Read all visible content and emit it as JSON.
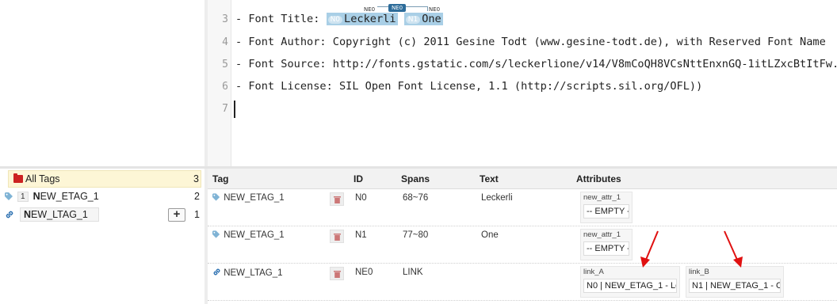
{
  "editor": {
    "lines": [
      {
        "no": "3",
        "prefix": "- Font Title: ",
        "entities": [
          {
            "badge": "N0",
            "text": "Leckerli"
          },
          {
            "badge": "N1",
            "text": "One"
          }
        ]
      },
      {
        "no": "4",
        "text": "- Font Author: Copyright (c) 2011 Gesine Todt (www.gesine-todt.de), with Reserved Font Name"
      },
      {
        "no": "5",
        "text": "- Font Source: http://fonts.gstatic.com/s/leckerlione/v14/V8mCoQH8VCsNttEnxnGQ-1itLZxcBtItFw.ttf"
      },
      {
        "no": "6",
        "text": "- Font License: SIL Open Font License, 1.1 (http://scripts.sil.org/OFL))"
      },
      {
        "no": "7",
        "text": ""
      }
    ],
    "link_labels": {
      "left": "NE0",
      "center": "NE0",
      "right": "NE0"
    }
  },
  "tree": {
    "all_tags": {
      "label": "All Tags",
      "count": "3"
    },
    "items": [
      {
        "chip": "1",
        "label_bold": "N",
        "label_rest": "EW_ETAG_1",
        "count": "2"
      },
      {
        "label_bold": "N",
        "label_rest": "EW_LTAG_1",
        "count": "1",
        "add": "+"
      }
    ]
  },
  "table": {
    "headers": {
      "tag": "Tag",
      "id": "ID",
      "spans": "Spans",
      "text": "Text",
      "attributes": "Attributes"
    },
    "rows": [
      {
        "tag": "NEW_ETAG_1",
        "id": "N0",
        "spans": "68~76",
        "text": "Leckerli",
        "attrs": [
          {
            "name": "new_attr_1",
            "value": "-- EMPTY --"
          }
        ]
      },
      {
        "tag": "NEW_ETAG_1",
        "id": "N1",
        "spans": "77~80",
        "text": "One",
        "attrs": [
          {
            "name": "new_attr_1",
            "value": "-- EMPTY --"
          }
        ]
      },
      {
        "tag": "NEW_LTAG_1",
        "id": "NE0",
        "spans": "LINK",
        "text": "",
        "attrs": [
          {
            "name": "link_A",
            "value": "N0 | NEW_ETAG_1 - Le"
          },
          {
            "name": "link_B",
            "value": "N1 | NEW_ETAG_1 - On"
          }
        ]
      }
    ]
  },
  "colors": {
    "entity_bg": "#a9cfe6",
    "arrow": "#e01010",
    "selected_bg": "#fdf6d6",
    "folder": "#cc2222",
    "link_icon": "#2a6fb0",
    "tag_icon": "#7fb3d5"
  }
}
